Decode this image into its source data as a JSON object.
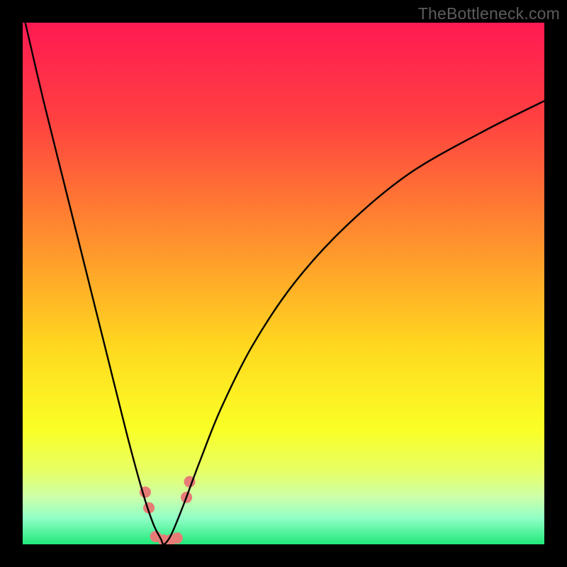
{
  "watermark": "TheBottleneck.com",
  "chart_data": {
    "type": "line",
    "title": "",
    "xlabel": "",
    "ylabel": "",
    "x_range": [
      0,
      100
    ],
    "y_range": [
      0,
      100
    ],
    "gradient_stops": [
      {
        "pct": 0,
        "color": "#ff1a52"
      },
      {
        "pct": 18,
        "color": "#ff3f41"
      },
      {
        "pct": 40,
        "color": "#ff8a2f"
      },
      {
        "pct": 62,
        "color": "#ffd81f"
      },
      {
        "pct": 78,
        "color": "#faff26"
      },
      {
        "pct": 86,
        "color": "#e7ff65"
      },
      {
        "pct": 91,
        "color": "#ccffaa"
      },
      {
        "pct": 95,
        "color": "#90ffc6"
      },
      {
        "pct": 100,
        "color": "#20e87a"
      }
    ],
    "curve": {
      "description": "V-shaped bottleneck curve; minimum near x≈27 where value ≈0, rising steeply to ~100 on the left edge and asymptotically toward ~85 on the right edge.",
      "min_x": 27,
      "left_top_y": 100,
      "right_end_y": 85,
      "samples_x": [
        0.5,
        4,
        8,
        12,
        16,
        20,
        23,
        25,
        26.5,
        27,
        28,
        29,
        31,
        34,
        38,
        44,
        52,
        62,
        74,
        88,
        100
      ],
      "samples_y": [
        100,
        85,
        69,
        53,
        37,
        21,
        10,
        4,
        1,
        0,
        1,
        3,
        8,
        16,
        26,
        38,
        50,
        61,
        71,
        79,
        85
      ]
    },
    "markers": {
      "color": "#e77c76",
      "radius_outer": 8,
      "radius_inner": 5,
      "points": [
        {
          "x": 23.5,
          "y": 10
        },
        {
          "x": 24.2,
          "y": 7
        },
        {
          "x": 25.5,
          "y": 1.5
        },
        {
          "x": 27.0,
          "y": 0.8
        },
        {
          "x": 28.3,
          "y": 0.8
        },
        {
          "x": 29.6,
          "y": 1.2
        },
        {
          "x": 31.4,
          "y": 9
        },
        {
          "x": 32.0,
          "y": 12
        }
      ]
    }
  }
}
